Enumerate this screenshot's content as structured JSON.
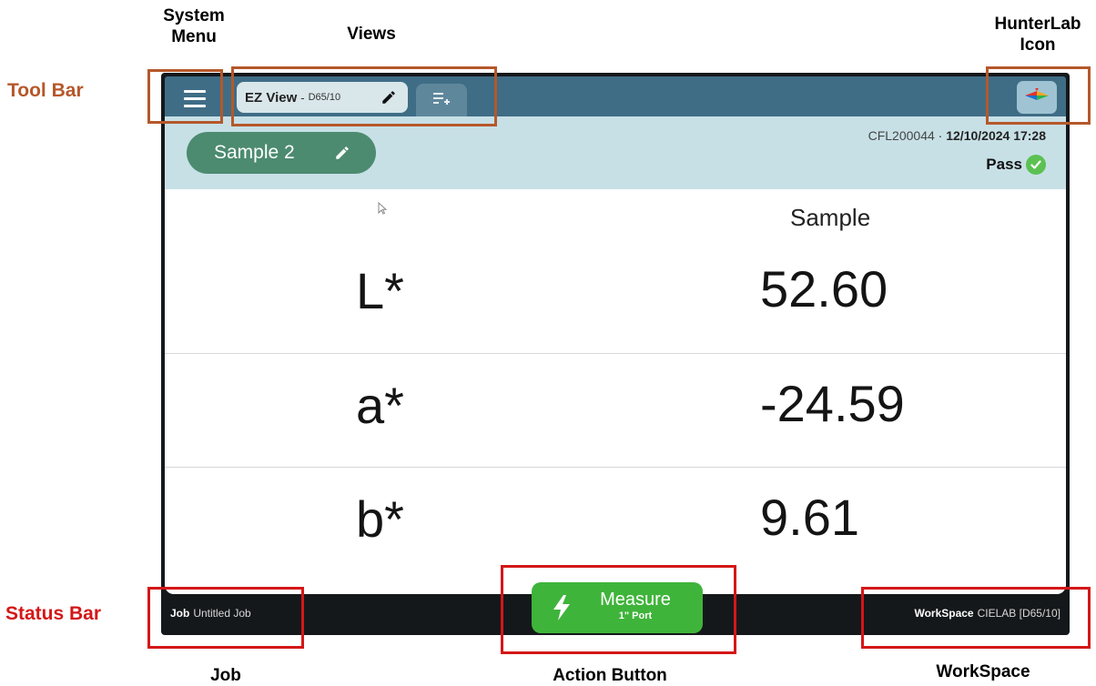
{
  "callouts": {
    "system_menu": [
      "System",
      "Menu"
    ],
    "views": "Views",
    "hunterlab_icon": [
      "HunterLab",
      "Icon"
    ],
    "tool_bar": "Tool Bar",
    "status_bar": "Status Bar",
    "job": "Job",
    "action_button": "Action Button",
    "workspace": "WorkSpace"
  },
  "toolbar": {
    "view_tab": {
      "name": "EZ View",
      "separator": "-",
      "illuminant": "D65/10"
    },
    "menu_icon": "hamburger-icon",
    "add_view_icon": "add-list-icon",
    "logo_icon": "hunterlab-logo-icon"
  },
  "header": {
    "sample_name": "Sample 2",
    "instrument_id": "CFL200044",
    "meta_separator": "·",
    "timestamp": "12/10/2024 17:28",
    "result": "Pass"
  },
  "table": {
    "column_header": "Sample",
    "rows": [
      {
        "label": "L*",
        "value": "52.60"
      },
      {
        "label": "a*",
        "value": "-24.59"
      },
      {
        "label": "b*",
        "value": "9.61"
      }
    ]
  },
  "status": {
    "job_label": "Job",
    "job_value": "Untitled Job",
    "workspace_label": "WorkSpace",
    "workspace_value": "CIELAB [D65/10]"
  },
  "action": {
    "label": "Measure",
    "sub": "1\" Port"
  },
  "colors": {
    "toolbar": "#3f6d86",
    "header_band": "#c7e0e6",
    "sample_pill": "#4c8b70",
    "measure_button": "#3fb43a",
    "pass_check": "#5cc152",
    "callout_orange": "#b5582a",
    "callout_red": "#d41717"
  }
}
